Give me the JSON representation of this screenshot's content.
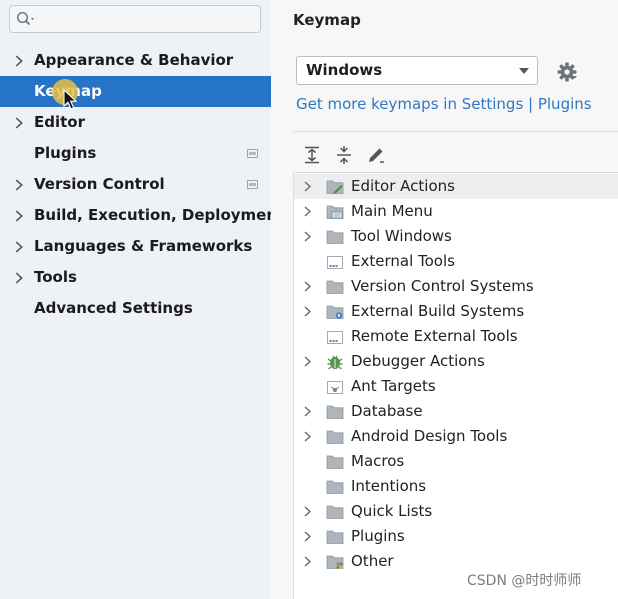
{
  "sidebar": {
    "search": {
      "placeholder": ""
    },
    "items": [
      {
        "label": "Appearance & Behavior",
        "expandable": true,
        "marker": false
      },
      {
        "label": "Keymap",
        "expandable": false,
        "marker": false,
        "selected": true
      },
      {
        "label": "Editor",
        "expandable": true,
        "marker": false
      },
      {
        "label": "Plugins",
        "expandable": false,
        "marker": true
      },
      {
        "label": "Version Control",
        "expandable": true,
        "marker": true
      },
      {
        "label": "Build, Execution, Deployment",
        "expandable": true,
        "marker": false
      },
      {
        "label": "Languages & Frameworks",
        "expandable": true,
        "marker": false
      },
      {
        "label": "Tools",
        "expandable": true,
        "marker": false
      },
      {
        "label": "Advanced Settings",
        "expandable": false,
        "marker": false
      }
    ]
  },
  "main": {
    "title": "Keymap",
    "keymap_select": {
      "value": "Windows"
    },
    "link": "Get more keymaps in Settings | Plugins",
    "toolbar": [
      "expand-all-icon",
      "collapse-all-icon",
      "edit-shortcut-icon"
    ],
    "tree": [
      {
        "label": "Editor Actions",
        "expandable": true,
        "icon": "editor-actions-icon",
        "highlighted": true
      },
      {
        "label": "Main Menu",
        "expandable": true,
        "icon": "menu-folder-icon"
      },
      {
        "label": "Tool Windows",
        "expandable": true,
        "icon": "folder-icon"
      },
      {
        "label": "External Tools",
        "expandable": false,
        "icon": "external-tools-icon"
      },
      {
        "label": "Version Control Systems",
        "expandable": true,
        "icon": "folder-icon"
      },
      {
        "label": "External Build Systems",
        "expandable": true,
        "icon": "build-folder-icon"
      },
      {
        "label": "Remote External Tools",
        "expandable": false,
        "icon": "external-tools-icon"
      },
      {
        "label": "Debugger Actions",
        "expandable": true,
        "icon": "bug-icon"
      },
      {
        "label": "Ant Targets",
        "expandable": false,
        "icon": "ant-icon"
      },
      {
        "label": "Database",
        "expandable": true,
        "icon": "folder-icon"
      },
      {
        "label": "Android Design Tools",
        "expandable": true,
        "icon": "folder-icon"
      },
      {
        "label": "Macros",
        "expandable": false,
        "icon": "folder-icon"
      },
      {
        "label": "Intentions",
        "expandable": false,
        "icon": "folder-icon"
      },
      {
        "label": "Quick Lists",
        "expandable": true,
        "icon": "folder-icon"
      },
      {
        "label": "Plugins",
        "expandable": true,
        "icon": "folder-icon"
      },
      {
        "label": "Other",
        "expandable": true,
        "icon": "other-folder-icon"
      }
    ]
  },
  "colors": {
    "selection": "#2574c5",
    "link": "#2f77c2",
    "sidebar_bg": "#eef1f5"
  },
  "watermark": "CSDN @时时师师"
}
